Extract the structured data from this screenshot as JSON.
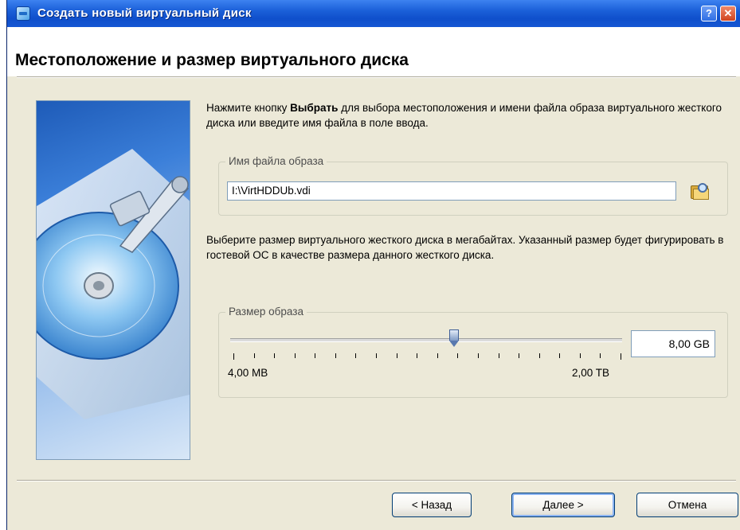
{
  "window": {
    "title": "Создать новый виртуальный диск",
    "help_label": "?",
    "close_label": "✕"
  },
  "header": {
    "title": "Местоположение и размер виртуального диска"
  },
  "file_section": {
    "description_prefix": "Нажмите кнопку ",
    "description_bold": "Выбрать",
    "description_suffix": " для выбора местоположения и имени файла образа виртуального жесткого диска или введите имя файла в поле ввода.",
    "group_label": "Имя файла образа",
    "file_path": "I:\\VirtHDDUb.vdi",
    "browse_icon": "folder-open-icon"
  },
  "size_section": {
    "description": "Выберите размер виртуального жесткого диска в мегабайтах. Указанный размер будет фигурировать в гостевой ОС в качестве размера данного жесткого диска.",
    "group_label": "Размер образа",
    "slider_min_label": "4,00 MB",
    "slider_max_label": "2,00 TB",
    "slider_position": 0.57,
    "size_value": "8,00 GB"
  },
  "buttons": {
    "back": "< Назад",
    "next": "Далее >",
    "cancel": "Отмена"
  },
  "colors": {
    "titlebar": "#1a5fd8",
    "dialog_bg": "#ece9d8",
    "accent_border": "#003c74"
  }
}
